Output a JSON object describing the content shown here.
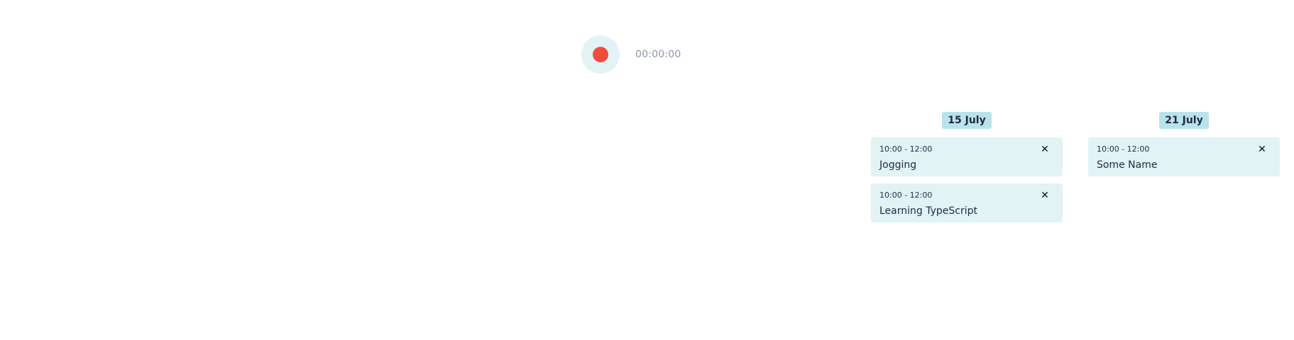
{
  "timer": {
    "record_icon": "record-icon",
    "elapsed": "00:00:00",
    "colors": {
      "button_bg": "#e2f3f6",
      "dot": "#ef4c3d"
    }
  },
  "days": [
    {
      "label": "15 July",
      "events": [
        {
          "time": "10:00 - 12:00",
          "name": "Jogging",
          "delete_icon": "✕"
        },
        {
          "time": "10:00 - 12:00",
          "name": "Learning TypeScript",
          "delete_icon": "✕"
        }
      ]
    },
    {
      "label": "21 July",
      "events": [
        {
          "time": "10:00 - 12:00",
          "name": "Some Name",
          "delete_icon": "✕"
        }
      ]
    }
  ],
  "colors": {
    "badge_bg": "#b9e3ea",
    "card_bg": "#e2f3f6",
    "text": "#1f2a44"
  }
}
